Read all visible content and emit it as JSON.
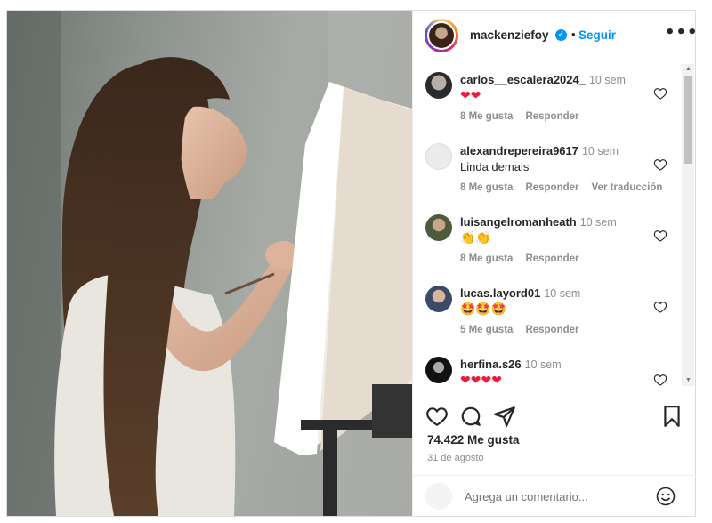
{
  "post": {
    "username": "mackenziefoy",
    "verified_icon": "verified-badge-icon",
    "separator": "•",
    "follow_label": "Seguir",
    "more_icon": "more-options-icon",
    "more_label": "•••"
  },
  "comments": [
    {
      "user": "carlos__escalera2024_",
      "time": "10 sem",
      "text": "❤❤",
      "emoji_color": "#ed1c3a",
      "likes": "8 Me gusta",
      "reply": "Responder",
      "translate": ""
    },
    {
      "user": "alexandrepereira9617",
      "time": "10 sem",
      "text": "Linda demais",
      "emoji_color": "",
      "likes": "8 Me gusta",
      "reply": "Responder",
      "translate": "Ver traducción"
    },
    {
      "user": "luisangelromanheath",
      "time": "10 sem",
      "text": "👏👏",
      "emoji_color": "#f0b400",
      "likes": "8 Me gusta",
      "reply": "Responder",
      "translate": ""
    },
    {
      "user": "lucas.layord01",
      "time": "10 sem",
      "text": "🤩🤩🤩",
      "emoji_color": "#f07b22",
      "likes": "5 Me gusta",
      "reply": "Responder",
      "translate": ""
    },
    {
      "user": "herfina.s26",
      "time": "10 sem",
      "text": "❤❤❤❤",
      "emoji_color": "#ed1c3a",
      "likes": "",
      "reply": "",
      "translate": ""
    }
  ],
  "actions": {
    "like_icon": "heart-outline-icon",
    "comment_icon": "comment-icon",
    "share_icon": "send-icon",
    "save_icon": "bookmark-icon"
  },
  "likes_count": "74.422 Me gusta",
  "date": "31 de agosto",
  "add_comment": {
    "placeholder": "Agrega un comentario...",
    "emoji_icon": "smiley-icon"
  },
  "colors": {
    "accent": "#0095f6",
    "text": "#262626",
    "muted": "#8e8e8e",
    "heart": "#ed1c3a"
  }
}
